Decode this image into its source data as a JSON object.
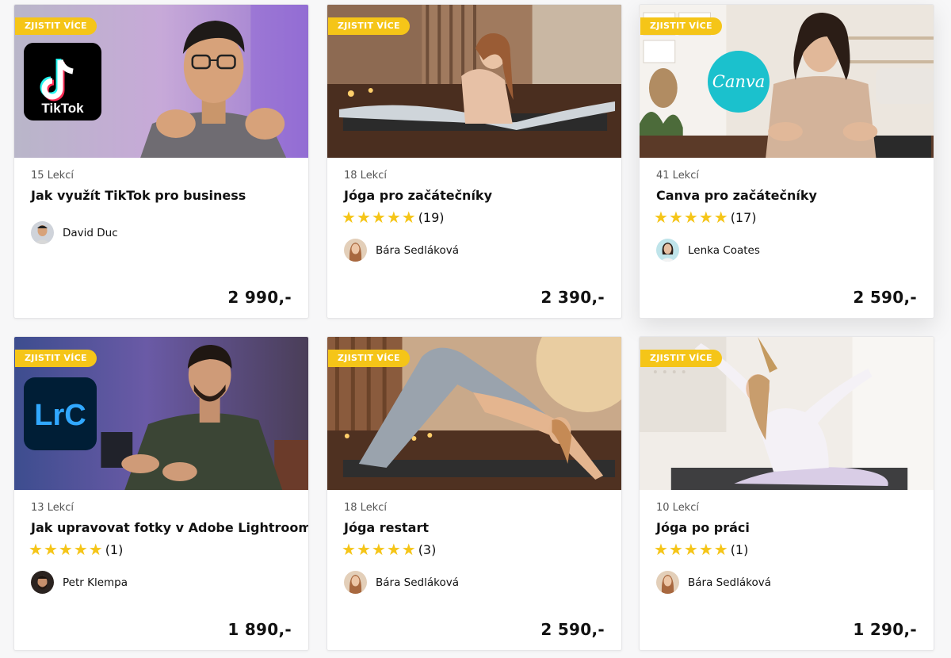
{
  "badge_label": "ZJISTIT VÍCE",
  "colors": {
    "accent": "#f5c518",
    "star": "#f5c518",
    "price": "#111111"
  },
  "courses": [
    {
      "lessons": "15 Lekcí",
      "title": "Jak využít TikTok pro business",
      "rating": null,
      "rating_count": null,
      "author": "David Duc",
      "price": "2 990,-",
      "logo_text": "TikTok",
      "icon": "tiktok-logo-icon"
    },
    {
      "lessons": "18 Lekcí",
      "title": "Jóga pro začátečníky",
      "rating": 5,
      "rating_count": "(19)",
      "author": "Bára Sedláková",
      "price": "2 390,-",
      "logo_text": null,
      "icon": null
    },
    {
      "lessons": "41 Lekcí",
      "title": "Canva pro začátečníky",
      "rating": 5,
      "rating_count": "(17)",
      "author": "Lenka Coates",
      "price": "2 590,-",
      "logo_text": "Canva",
      "icon": "canva-logo-icon"
    },
    {
      "lessons": "13 Lekcí",
      "title": "Jak upravovat fotky v Adobe Lightroom",
      "rating": 5,
      "rating_count": "(1)",
      "author": "Petr Klempa",
      "price": "1 890,-",
      "logo_text": "LrC",
      "icon": "lightroom-logo-icon"
    },
    {
      "lessons": "18 Lekcí",
      "title": "Jóga restart",
      "rating": 5,
      "rating_count": "(3)",
      "author": "Bára Sedláková",
      "price": "2 590,-",
      "logo_text": null,
      "icon": null
    },
    {
      "lessons": "10 Lekcí",
      "title": "Jóga po práci",
      "rating": 5,
      "rating_count": "(1)",
      "author": "Bára Sedláková",
      "price": "1 290,-",
      "logo_text": null,
      "icon": null
    }
  ]
}
